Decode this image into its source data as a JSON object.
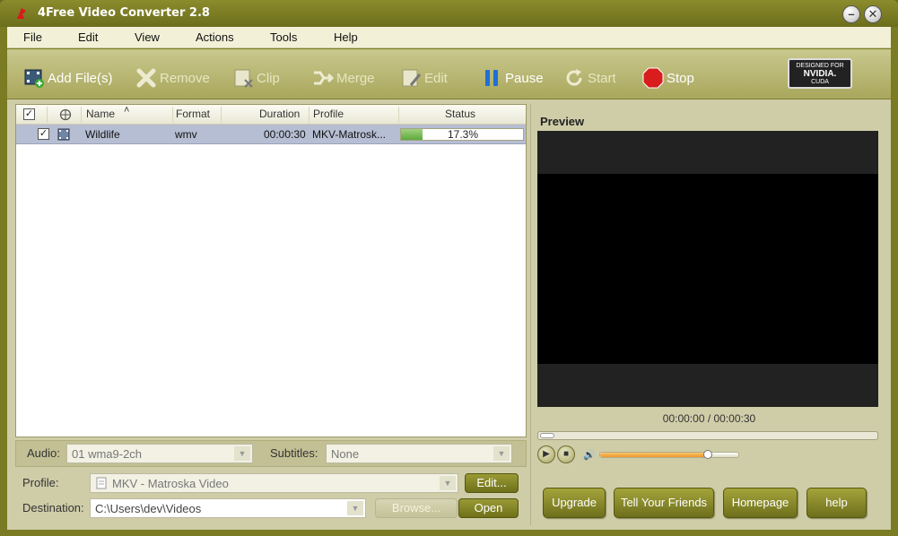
{
  "window": {
    "title": "4Free Video Converter 2.8",
    "min_glyph": "–",
    "close_glyph": "✕"
  },
  "menu": [
    "File",
    "Edit",
    "View",
    "Actions",
    "Tools",
    "Help"
  ],
  "toolbar": {
    "add": "Add File(s)",
    "remove": "Remove",
    "clip": "Clip",
    "merge": "Merge",
    "edit": "Edit",
    "pause": "Pause",
    "start": "Start",
    "stop": "Stop",
    "nvidia_top": "DESIGNED FOR",
    "nvidia_mid": "NVIDIA.",
    "nvidia_bot": "CUDA"
  },
  "file_list": {
    "columns": {
      "name": "Name",
      "sort_indicator": "˄",
      "format": "Format",
      "duration": "Duration",
      "profile": "Profile",
      "status": "Status"
    },
    "rows": [
      {
        "checked": "✓",
        "name": "Wildlife",
        "format": "wmv",
        "duration": "00:00:30",
        "profile": "MKV-Matrosk...",
        "status": "17.3%",
        "progress": 0.173
      }
    ]
  },
  "options": {
    "audio_label": "Audio:",
    "audio_value": "01 wma9-2ch",
    "subtitles_label": "Subtitles:",
    "subtitles_value": "None",
    "profile_label": "Profile:",
    "profile_value": "MKV - Matroska Video",
    "edit_button": "Edit...",
    "destination_label": "Destination:",
    "destination_value": "C:\\Users\\dev\\Videos",
    "browse_button": "Browse...",
    "open_button": "Open"
  },
  "preview": {
    "title": "Preview",
    "time": "00:00:00 / 00:00:30",
    "volume": 0.78,
    "play_glyph": "▶",
    "stop_glyph": "■",
    "volume_glyph": "🔊"
  },
  "bottom_buttons": [
    "Upgrade",
    "Tell Your Friends",
    "Homepage",
    "help"
  ],
  "colors": {
    "frame": "#7a7b22",
    "toolbar": "#b8b673",
    "selection": "#b6bed3",
    "progress": "#5ea93c"
  }
}
